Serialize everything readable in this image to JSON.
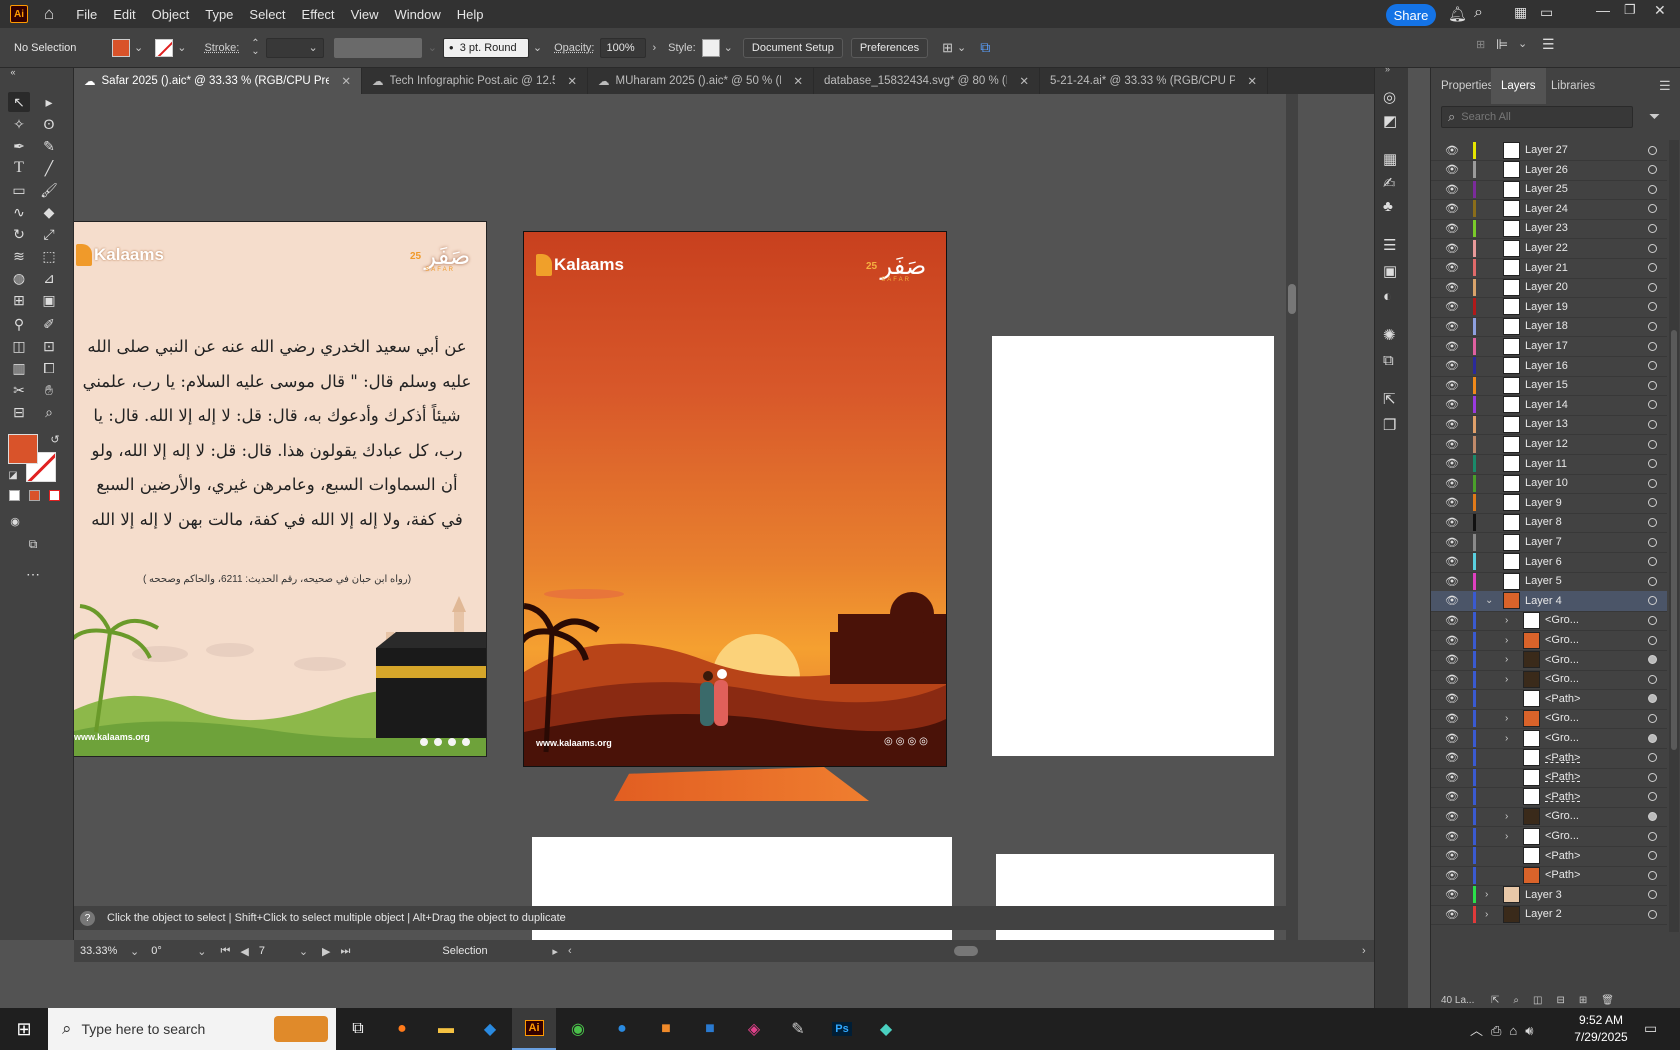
{
  "app": {
    "logo": "Ai"
  },
  "menu": [
    "File",
    "Edit",
    "Object",
    "Type",
    "Select",
    "Effect",
    "View",
    "Window",
    "Help"
  ],
  "share_label": "Share",
  "control": {
    "selection": "No Selection",
    "stroke_label": "Stroke:",
    "brush": "3 pt. Round",
    "opacity_label": "Opacity:",
    "opacity_value": "100%",
    "style_label": "Style:",
    "document_setup": "Document Setup",
    "preferences": "Preferences"
  },
  "tabs": [
    {
      "label": "Safar 2025 ().aic* @ 33.33 % (RGB/CPU Preview)",
      "active": true
    },
    {
      "label": "Tech Infographic Post.aic @ 12.5 ...",
      "active": false
    },
    {
      "label": "MUharam 2025 ().aic* @ 50 % (RG...",
      "active": false
    },
    {
      "label": "database_15832434.svg* @ 80 % (RGB...",
      "active": false
    },
    {
      "label": "5-21-24.ai* @ 33.33 % (RGB/CPU Previ...",
      "active": false
    }
  ],
  "artboard1": {
    "brand": "Kalaams",
    "safar_ar": "صَفَر",
    "safar_en": "SAFAR",
    "year": "25",
    "hadith_lines": [
      "عن أبي سعيد الخدري رضي الله عنه عن النبي صلى الله",
      "عليه وسلم قال: \" قال موسى عليه السلام: يا رب، علمني",
      "شيئاً أذكرك وأدعوك به، قال: قل: لا إله إلا الله. قال: يا",
      "رب، كل عبادك يقولون هذا. قال: قل: لا إله إلا الله، ولو",
      "أن السماوات السبع، وعامرهن غيري، والأرضين السبع",
      "في كفة، ولا إله إلا الله في كفة، مالت بهن لا إله إلا الله"
    ],
    "reference": "(رواه ابن حبان في صحيحه، رقم الحديث: 6211، والحاكم وصححه )",
    "website": "www.kalaams.org"
  },
  "artboard2": {
    "brand": "Kalaams",
    "safar_ar": "صَفَر",
    "safar_en": "SAFAR",
    "year": "25",
    "website": "www.kalaams.org"
  },
  "status": {
    "hint": "Click the object to select  |  Shift+Click to select multiple object  |  Alt+Drag the object to duplicate",
    "zoom": "33.33%",
    "rotation": "0°",
    "artboard_num": "7",
    "tool": "Selection"
  },
  "panel": {
    "tabs": [
      "Properties",
      "Layers",
      "Libraries"
    ],
    "search_placeholder": "Search All",
    "footer": "40 La...",
    "layers": [
      {
        "name": "Layer 27",
        "color": "#e6e600",
        "thumb": "white",
        "indent": 0,
        "chev": false,
        "circ": "empty"
      },
      {
        "name": "Layer 26",
        "color": "#9b9b9b",
        "thumb": "white",
        "indent": 0,
        "chev": false,
        "circ": "empty"
      },
      {
        "name": "Layer 25",
        "color": "#7b2b9b",
        "thumb": "white",
        "indent": 0,
        "chev": false,
        "circ": "empty"
      },
      {
        "name": "Layer 24",
        "color": "#8a6d1a",
        "thumb": "white",
        "indent": 0,
        "chev": false,
        "circ": "empty"
      },
      {
        "name": "Layer 23",
        "color": "#7acb2a",
        "thumb": "white",
        "indent": 0,
        "chev": false,
        "circ": "empty"
      },
      {
        "name": "Layer 22",
        "color": "#e89a9a",
        "thumb": "white",
        "indent": 0,
        "chev": false,
        "circ": "empty"
      },
      {
        "name": "Layer 21",
        "color": "#e06a6a",
        "thumb": "white",
        "indent": 0,
        "chev": false,
        "circ": "empty"
      },
      {
        "name": "Layer 20",
        "color": "#d9a36b",
        "thumb": "white",
        "indent": 0,
        "chev": false,
        "circ": "empty"
      },
      {
        "name": "Layer 19",
        "color": "#b11a1a",
        "thumb": "white",
        "indent": 0,
        "chev": false,
        "circ": "empty"
      },
      {
        "name": "Layer 18",
        "color": "#8ea0e0",
        "thumb": "white",
        "indent": 0,
        "chev": false,
        "circ": "empty"
      },
      {
        "name": "Layer 17",
        "color": "#e060a0",
        "thumb": "white",
        "indent": 0,
        "chev": false,
        "circ": "empty"
      },
      {
        "name": "Layer 16",
        "color": "#2a2a9b",
        "thumb": "white",
        "indent": 0,
        "chev": false,
        "circ": "empty"
      },
      {
        "name": "Layer 15",
        "color": "#f08a1a",
        "thumb": "white",
        "indent": 0,
        "chev": false,
        "circ": "empty"
      },
      {
        "name": "Layer 14",
        "color": "#9b3ae0",
        "thumb": "white",
        "indent": 0,
        "chev": false,
        "circ": "empty"
      },
      {
        "name": "Layer 13",
        "color": "#e0a06a",
        "thumb": "white",
        "indent": 0,
        "chev": false,
        "circ": "empty"
      },
      {
        "name": "Layer 12",
        "color": "#c08a6a",
        "thumb": "white",
        "indent": 0,
        "chev": false,
        "circ": "empty"
      },
      {
        "name": "Layer 11",
        "color": "#1a8a6a",
        "thumb": "white",
        "indent": 0,
        "chev": false,
        "circ": "empty"
      },
      {
        "name": "Layer 10",
        "color": "#4aa02a",
        "thumb": "white",
        "indent": 0,
        "chev": false,
        "circ": "empty"
      },
      {
        "name": "Layer 9",
        "color": "#e07a1a",
        "thumb": "white",
        "indent": 0,
        "chev": false,
        "circ": "empty"
      },
      {
        "name": "Layer 8",
        "color": "#111111",
        "thumb": "white",
        "indent": 0,
        "chev": false,
        "circ": "empty"
      },
      {
        "name": "Layer 7",
        "color": "#8a8a8a",
        "thumb": "white",
        "indent": 0,
        "chev": false,
        "circ": "empty"
      },
      {
        "name": "Layer 6",
        "color": "#5ad0e0",
        "thumb": "white",
        "indent": 0,
        "chev": false,
        "circ": "empty"
      },
      {
        "name": "Layer 5",
        "color": "#e040c0",
        "thumb": "white",
        "indent": 0,
        "chev": false,
        "circ": "empty"
      },
      {
        "name": "Layer 4",
        "color": "#3a5ad0",
        "thumb": "orange",
        "indent": 0,
        "chev": true,
        "expanded": true,
        "circ": "empty",
        "selected": true
      },
      {
        "name": "<Gro...",
        "color": "#3a5ad0",
        "thumb": "white",
        "indent": 1,
        "chev": true,
        "circ": "empty"
      },
      {
        "name": "<Gro...",
        "color": "#3a5ad0",
        "thumb": "orange",
        "indent": 1,
        "chev": true,
        "circ": "empty"
      },
      {
        "name": "<Gro...",
        "color": "#3a5ad0",
        "thumb": "dark",
        "indent": 1,
        "chev": true,
        "circ": "fill"
      },
      {
        "name": "<Gro...",
        "color": "#3a5ad0",
        "thumb": "dark",
        "indent": 1,
        "chev": true,
        "circ": "empty"
      },
      {
        "name": "<Path>",
        "color": "#3a5ad0",
        "thumb": "white",
        "indent": 1,
        "chev": false,
        "circ": "fill"
      },
      {
        "name": "<Gro...",
        "color": "#3a5ad0",
        "thumb": "orange",
        "indent": 1,
        "chev": true,
        "circ": "empty"
      },
      {
        "name": "<Gro...",
        "color": "#3a5ad0",
        "thumb": "white",
        "indent": 1,
        "chev": true,
        "circ": "fill"
      },
      {
        "name": "<Path>",
        "color": "#3a5ad0",
        "thumb": "white",
        "indent": 1,
        "chev": false,
        "circ": "empty"
      },
      {
        "name": "<Path>",
        "color": "#3a5ad0",
        "thumb": "white",
        "indent": 1,
        "chev": false,
        "circ": "empty"
      },
      {
        "name": "<Path>",
        "color": "#3a5ad0",
        "thumb": "white",
        "indent": 1,
        "chev": false,
        "circ": "empty"
      },
      {
        "name": "<Gro...",
        "color": "#3a5ad0",
        "thumb": "dark",
        "indent": 1,
        "chev": true,
        "circ": "fill"
      },
      {
        "name": "<Gro...",
        "color": "#3a5ad0",
        "thumb": "white",
        "indent": 1,
        "chev": true,
        "circ": "empty"
      },
      {
        "name": "<Path>",
        "color": "#3a5ad0",
        "thumb": "white",
        "indent": 1,
        "chev": false,
        "circ": "empty"
      },
      {
        "name": "<Path>",
        "color": "#3a5ad0",
        "thumb": "orange",
        "indent": 1,
        "chev": false,
        "circ": "empty"
      },
      {
        "name": "Layer 3",
        "color": "#2ae04a",
        "thumb": "beige",
        "indent": 0,
        "chev": true,
        "circ": "empty"
      },
      {
        "name": "Layer 2",
        "color": "#e03a3a",
        "thumb": "dark",
        "indent": 0,
        "chev": true,
        "circ": "empty"
      }
    ]
  },
  "taskbar": {
    "search_placeholder": "Type here to search",
    "time": "9:52 AM",
    "date": "7/29/2025"
  },
  "colors": {
    "accent": "#1473e6",
    "fill": "#d9532a",
    "ui_dark": "#323232"
  }
}
